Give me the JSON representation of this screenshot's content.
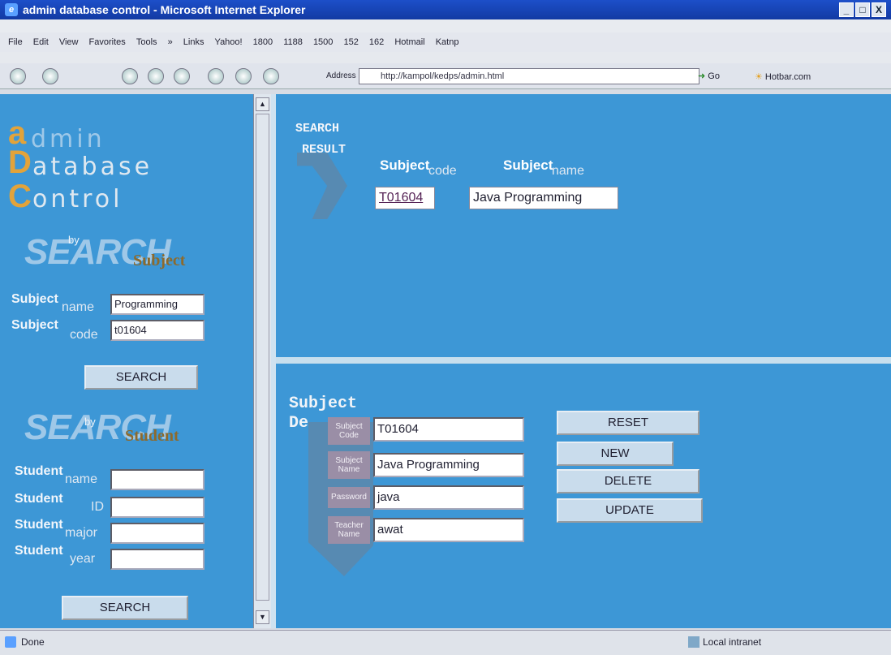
{
  "window": {
    "title": "admin database control - Microsoft Internet Explorer",
    "buttons": {
      "min": "_",
      "max": "□",
      "close": "X"
    }
  },
  "menubar": {
    "items": [
      "File",
      "Edit",
      "View",
      "Favorites",
      "Tools",
      "»",
      "Links",
      "Yahoo!",
      "1800",
      "1188",
      "1500",
      "152",
      "162",
      "Hotmail",
      "Katnp"
    ]
  },
  "toolbar": {
    "address_label": "Address",
    "address_url": "http://kampol/kedps/admin.html",
    "go_label": "Go",
    "extra_link": "Hotbar.com"
  },
  "left": {
    "logo": {
      "a": "a",
      "admin": "dmin",
      "D": "D",
      "database": "atabase",
      "C": "C",
      "control": "ontrol"
    },
    "search_ghost": "SEARCH",
    "by_subject": {
      "by": "by",
      "word": "Subject"
    },
    "subject_name_label": "Subject",
    "subject_name_sub": "name",
    "subject_name_value": "Programming",
    "subject_code_label": "Subject",
    "subject_code_sub": "code",
    "subject_code_value": "t01604",
    "search_button": "SEARCH",
    "by_student": {
      "by": "by",
      "word": "Student"
    },
    "student_fields": [
      {
        "label": "Student",
        "sub": "name",
        "value": ""
      },
      {
        "label": "Student",
        "sub": "ID",
        "value": ""
      },
      {
        "label": "Student",
        "sub": "major",
        "value": ""
      },
      {
        "label": "Student",
        "sub": "year",
        "value": ""
      }
    ],
    "student_search_button": "SEARCH"
  },
  "result": {
    "label_line1": "SEARCH",
    "label_line2": "RESULT",
    "col_code_main": "Subject",
    "col_code_sub": "code",
    "col_name_main": "Subject",
    "col_name_sub": "name",
    "row": {
      "code": "T01604",
      "name": "Java Programming"
    }
  },
  "detail": {
    "title_line1": "Subject",
    "title_line2": "De",
    "fields": [
      {
        "label": "Subject Code",
        "value": "T01604"
      },
      {
        "label": "Subject Name",
        "value": "Java Programming"
      },
      {
        "label": "Password",
        "value": "java"
      },
      {
        "label": "Teacher Name",
        "value": "awat"
      }
    ],
    "buttons": {
      "reset": "RESET",
      "new": "NEW",
      "delete": "DELETE",
      "update": "UPDATE"
    }
  },
  "status": {
    "left": "Done",
    "zone": "Local intranet"
  }
}
